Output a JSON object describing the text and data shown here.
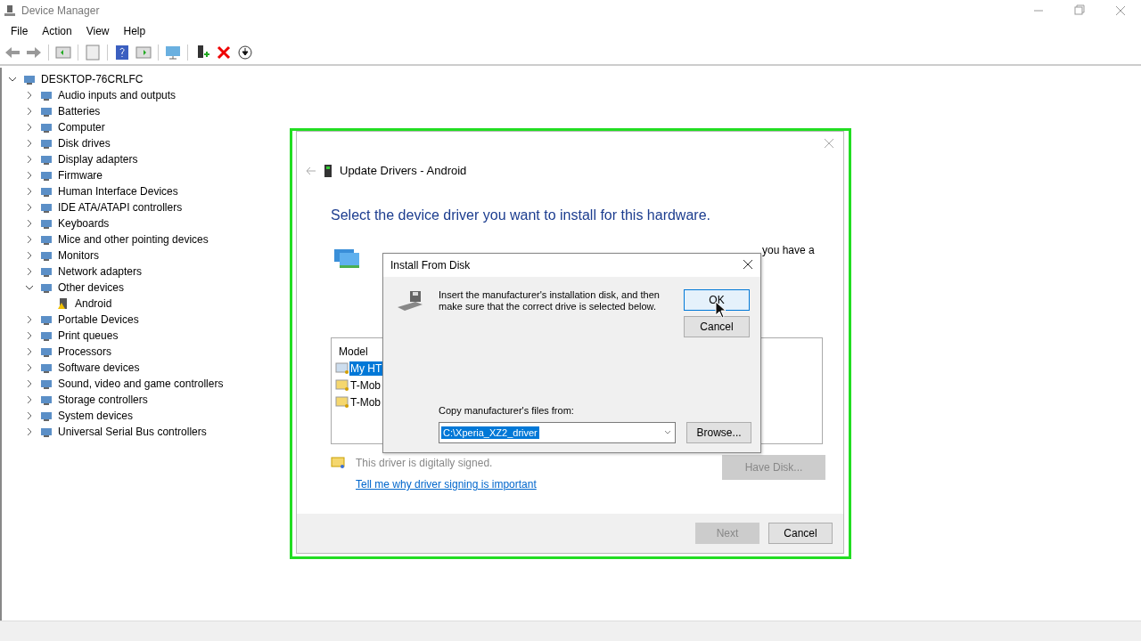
{
  "window": {
    "title": "Device Manager"
  },
  "menu": [
    "File",
    "Action",
    "View",
    "Help"
  ],
  "tree": {
    "label": "DESKTOP-76CRLFC",
    "expanded": true,
    "children": [
      {
        "label": "Audio inputs and outputs",
        "expanded": false
      },
      {
        "label": "Batteries",
        "expanded": false
      },
      {
        "label": "Computer",
        "expanded": false
      },
      {
        "label": "Disk drives",
        "expanded": false
      },
      {
        "label": "Display adapters",
        "expanded": false
      },
      {
        "label": "Firmware",
        "expanded": false
      },
      {
        "label": "Human Interface Devices",
        "expanded": false
      },
      {
        "label": "IDE ATA/ATAPI controllers",
        "expanded": false
      },
      {
        "label": "Keyboards",
        "expanded": false
      },
      {
        "label": "Mice and other pointing devices",
        "expanded": false
      },
      {
        "label": "Monitors",
        "expanded": false
      },
      {
        "label": "Network adapters",
        "expanded": false
      },
      {
        "label": "Other devices",
        "expanded": true,
        "children": [
          {
            "label": "Android",
            "warning": true
          }
        ]
      },
      {
        "label": "Portable Devices",
        "expanded": false
      },
      {
        "label": "Print queues",
        "expanded": false
      },
      {
        "label": "Processors",
        "expanded": false
      },
      {
        "label": "Software devices",
        "expanded": false
      },
      {
        "label": "Sound, video and game controllers",
        "expanded": false
      },
      {
        "label": "Storage controllers",
        "expanded": false
      },
      {
        "label": "System devices",
        "expanded": false
      },
      {
        "label": "Universal Serial Bus controllers",
        "expanded": false
      }
    ]
  },
  "wizard": {
    "title": "Update Drivers - Android",
    "heading": "Select the device driver you want to install for this hardware.",
    "instruction_visible": "you have a",
    "model_header": "Model",
    "models": [
      {
        "label": "My HT",
        "selected": true
      },
      {
        "label": "T-Mob",
        "selected": false
      },
      {
        "label": "T-Mob",
        "selected": false
      }
    ],
    "signed_text": "This driver is digitally signed.",
    "link": "Tell me why driver signing is important",
    "have_disk": {
      "label": "Have Disk...",
      "disabled": true
    },
    "buttons": [
      {
        "label": "Next",
        "disabled": true
      },
      {
        "label": "Cancel",
        "disabled": false
      }
    ]
  },
  "dialog": {
    "title": "Install From Disk",
    "message": "Insert the manufacturer's installation disk, and then make sure that the correct drive is selected below.",
    "ok": "OK",
    "cancel": "Cancel",
    "copy_label": "Copy manufacturer's files from:",
    "path": "C:\\Xperia_XZ2_driver",
    "browse": "Browse..."
  }
}
